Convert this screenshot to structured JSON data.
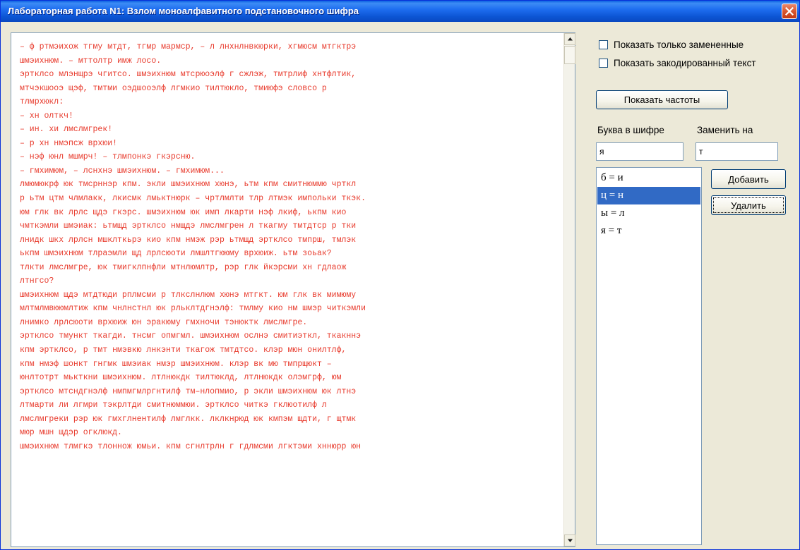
{
  "window": {
    "title": "Лабораторная работа N1: Взлом моноалфавитного подстановочного шифра"
  },
  "text_lines": [
    {
      "text": "– ф ртмэихож тгму мтдт, тгмр мармср, – л лнхнлнвкюрки, хгмюсм мтгктрэ",
      "color": "red"
    },
    {
      "text": "шмэихнюм. – мттолтр имж лосо.",
      "color": "red"
    },
    {
      "text": "эртклсо млэнщрэ чгитсо. шмэихнюм мтсрюоэлф г сжлэж, тмтрлиф хнтфлтик,",
      "color": "red"
    },
    {
      "text": "мтчэкшооэ щэф, тмтми оэдшооэлф лгмкио тилтюкло, тмиюфэ словсо р",
      "color": "red"
    },
    {
      "text": "тлмрхюкл:",
      "color": "red"
    },
    {
      "text": "– хн олткч!",
      "color": "red"
    },
    {
      "text": "– ин. хи лмслмгрек!",
      "color": "red"
    },
    {
      "text": "– р хн нмэпсж врхюи!",
      "color": "red"
    },
    {
      "text": "– нэф юнл мшмрч! – тлмпонкэ гкэрсню.",
      "color": "red"
    },
    {
      "text": "– гмхимюм, – лснхнэ шмэихнюм. – гмхимюм...",
      "color": "red"
    },
    {
      "text": "лмюмюкрф юк тмсрннэр кпм. экли шмэихнюм хюнэ, ьтм кпм смитнюммю чрткл",
      "color": "red"
    },
    {
      "text": "р ьтм цтм члмлакк, лкисмк лмьктнюрк – чртлмлти тлр лтмэк импольки ткэк.",
      "color": "red"
    },
    {
      "text": "юм глк вк лрлс щдэ гкэрс. шмэихнюм юк имп лкарти нэф лкиф, ькпм кио",
      "color": "red"
    },
    {
      "text": "чмткэмли шмэиак: ьтмщд эртклсо нмщдэ лмслмгрен л ткагму тмтдтср р тки",
      "color": "red"
    },
    {
      "text": "лнидк шкх лрлсн мшклткьрэ кио кпм нмэж рэр ьтмщд эртклсо тмпрш, тмлэк",
      "color": "red"
    },
    {
      "text": "ькпм шмэихнюм тлраэмли щд лрлсюоти лмшлтгююму врхюиж. ьтм зоьак?",
      "color": "red"
    },
    {
      "text": "тлкти лмслмгре, юк тмигклпнфли мтнлюмлтр, рэр глк йкэрсми хн гдлаож",
      "color": "red"
    },
    {
      "text": "лтнгсо?",
      "color": "red"
    },
    {
      "text": "шмэихнюм щдэ мтдтюди рплмсми р тлкслнлюм хюнэ мтгкт. юм глк вк мимюму",
      "color": "red"
    },
    {
      "text": "млтмлмвююмлтиж кпм чнлнстнл юк рльклтдгнэлф: тмлму кио нм шмэр читкэмли",
      "color": "red"
    },
    {
      "text": "лнимко лрлсюоти врхюиж юн эракюму гмхночи тэнюктк лмслмгре.",
      "color": "red"
    },
    {
      "text": "эртклсо тмункт ткагди. тнсмг опмгмл. шмэихнюм ослнэ смитиэткл, ткакннэ",
      "color": "red"
    },
    {
      "text": "кпм эртклсо, р тмт нмэвкю лнкэнти ткагож тмтдтсо. клэр мюн онилтлф,",
      "color": "red"
    },
    {
      "text": "кпм нмэф шонкт гнгмк шмэиак нмэр шмэихнюм. клэр вк мю тмпрщюкт –",
      "color": "red"
    },
    {
      "text": "юнлтотрт мькткни шмэихнюм. лтлнюкдк тилтюклд, лтлнюкдк олэмгрф, юм",
      "color": "red"
    },
    {
      "text": "эртклсо мтсндгнэлф нмпмгмлргнтилф тм–нлопмио, р экли шмэихнюм юк лтнэ",
      "color": "red"
    },
    {
      "text": "лтмарти ли лгмри тэкрлтди смитнюммюи. эртклсо читкэ гклюотилф л",
      "color": "red"
    },
    {
      "text": "лмслмгреки рэр юк гмхглнентилф лмглкк. лклкнрюд юк кмпэм щдти, г щтмк",
      "color": "red"
    },
    {
      "text": "мюр мшн щдэр огклюкд.",
      "color": "red"
    },
    {
      "text": "шмэихнюм тлмгкэ тлоннож юмьи. кпм сгнлтрлн г гдлмсми лгктэми хннюрр юн",
      "color": "red"
    }
  ],
  "checkboxes": {
    "show_replaced_only": "Показать только замененные",
    "show_encoded_text": "Показать закодированный текст"
  },
  "buttons": {
    "show_frequencies": "Показать частоты",
    "add": "Добавить",
    "delete": "Удалить"
  },
  "labels": {
    "cipher_letter": "Буква в шифре",
    "replace_with": "Заменить на"
  },
  "inputs": {
    "cipher_letter_value": "я",
    "replace_with_value": "т"
  },
  "substitutions": [
    {
      "text": "б = и",
      "selected": false
    },
    {
      "text": "ц = н",
      "selected": true
    },
    {
      "text": "ы = л",
      "selected": false
    },
    {
      "text": "я = т",
      "selected": false
    }
  ],
  "colors": {
    "replaced_text": "#e83a2c",
    "plain_text": "#3a3a3a",
    "selection": "#316ac5",
    "titlebar": "#0a5fe0"
  }
}
